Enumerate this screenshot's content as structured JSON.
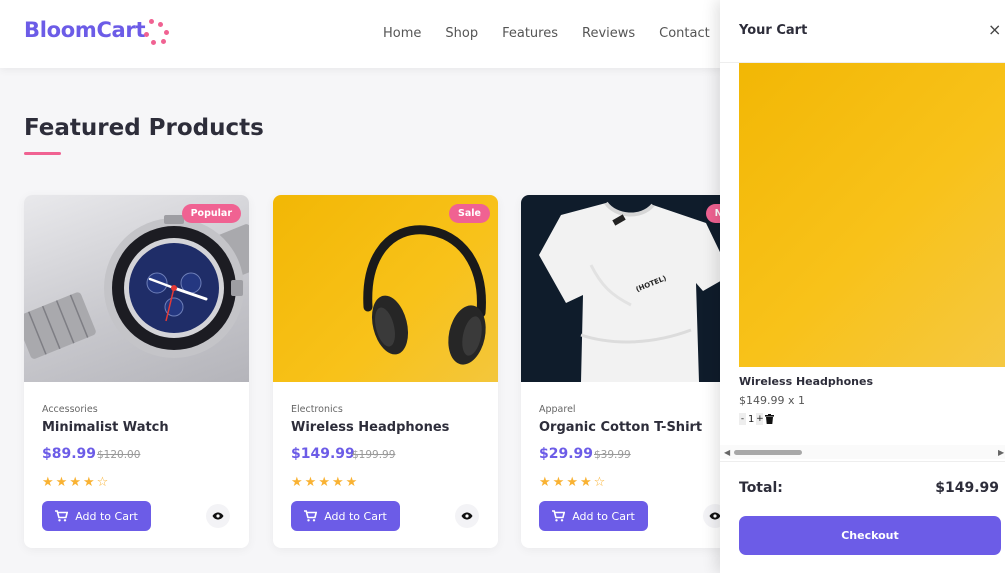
{
  "brand": {
    "name": "BloomCart",
    "accent": "#6c5ce7",
    "pink": "#f06292"
  },
  "nav": {
    "items": [
      "Home",
      "Shop",
      "Features",
      "Reviews",
      "Contact"
    ]
  },
  "section": {
    "title": "Featured Products"
  },
  "products": [
    {
      "badge": "Popular",
      "category": "Accessories",
      "name": "Minimalist Watch",
      "price": "$89.99",
      "old_price": "$120.00",
      "rating": 4,
      "rating_max": 5,
      "add_label": "Add to Cart",
      "image_icon": "wristwatch"
    },
    {
      "badge": "Sale",
      "category": "Electronics",
      "name": "Wireless Headphones",
      "price": "$149.99",
      "old_price": "$199.99",
      "rating": 5,
      "rating_max": 5,
      "add_label": "Add to Cart",
      "image_icon": "headphones"
    },
    {
      "badge": "Ne",
      "category": "Apparel",
      "name": "Organic Cotton T-Shirt",
      "price": "$29.99",
      "old_price": "$39.99",
      "rating": 4,
      "rating_max": 5,
      "add_label": "Add to Cart",
      "image_icon": "t-shirt",
      "tshirt_print": "(HOTEL)"
    }
  ],
  "cart": {
    "title": "Your Cart",
    "close_glyph": "×",
    "item": {
      "name": "Wireless Headphones",
      "price_line": "$149.99 x 1",
      "qty_minus": "-",
      "qty": "1",
      "qty_plus": "+"
    },
    "total_label": "Total:",
    "total_value": "$149.99",
    "checkout_label": "Checkout"
  }
}
